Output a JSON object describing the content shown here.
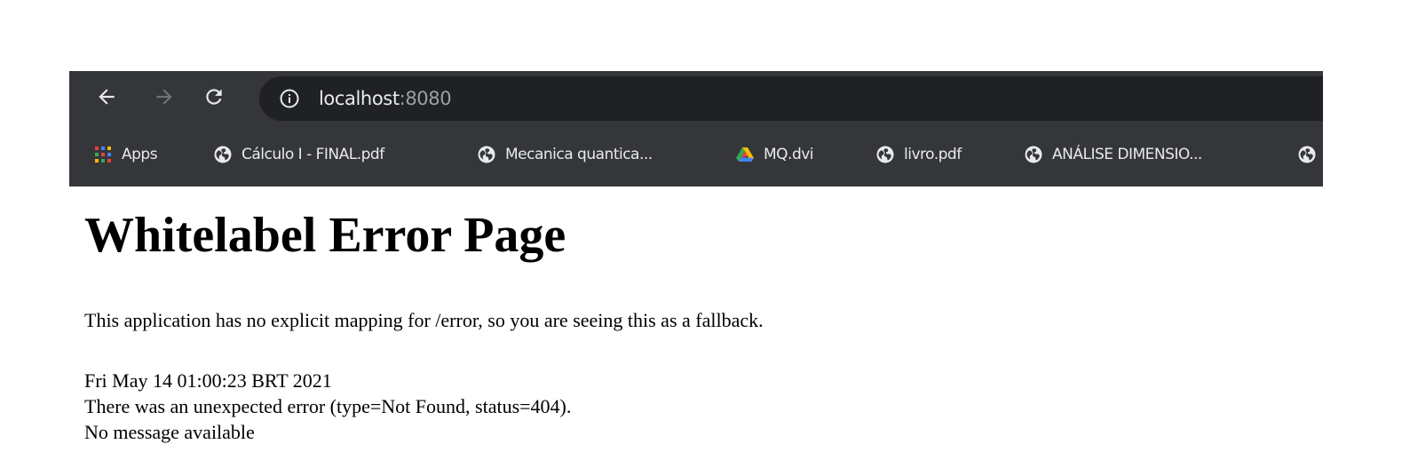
{
  "browser": {
    "toolbar": {
      "url_host": "localhost",
      "url_port": ":8080"
    },
    "bookmarks": [
      {
        "icon": "apps-grid-icon",
        "label": "Apps"
      },
      {
        "icon": "globe-icon",
        "label": "Cálculo I - FINAL.pdf"
      },
      {
        "icon": "globe-icon",
        "label": "Mecanica quantica..."
      },
      {
        "icon": "drive-icon",
        "label": "MQ.dvi"
      },
      {
        "icon": "globe-icon",
        "label": "livro.pdf"
      },
      {
        "icon": "globe-icon",
        "label": "ANÁLISE DIMENSIO..."
      },
      {
        "icon": "globe-icon",
        "label": ""
      }
    ]
  },
  "page": {
    "title": "Whitelabel Error Page",
    "message": "This application has no explicit mapping for /error, so you are seeing this as a fallback.",
    "timestamp": "Fri May 14 01:00:23 BRT 2021",
    "error_line": "There was an unexpected error (type=Not Found, status=404).",
    "detail": "No message available"
  },
  "colors": {
    "toolbar_bg": "#35363a",
    "omnibox_bg": "#202124",
    "text_light": "#e8eaed",
    "text_dim": "#9aa0a6"
  }
}
